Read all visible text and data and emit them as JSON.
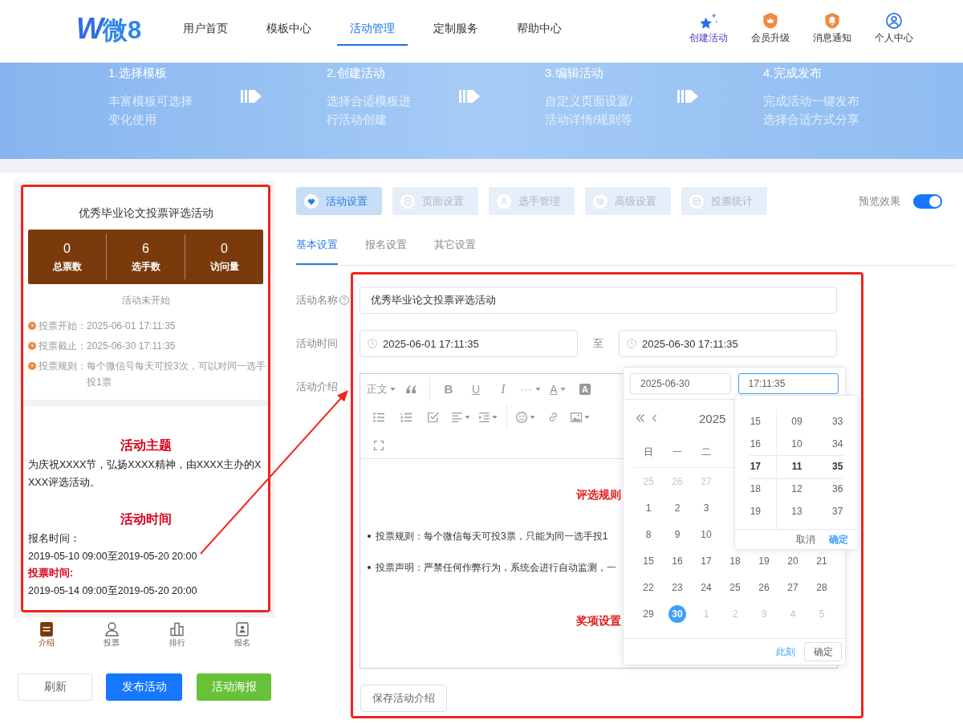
{
  "header": {
    "logo": {
      "mark": "W",
      "text": "微8"
    },
    "nav": [
      {
        "label": "用户首页",
        "selected": false
      },
      {
        "label": "模板中心",
        "selected": false
      },
      {
        "label": "活动管理",
        "selected": true
      },
      {
        "label": "定制服务",
        "selected": false
      },
      {
        "label": "帮助中心",
        "selected": false
      }
    ],
    "actions": [
      {
        "kind": "create",
        "label": "创建活动"
      },
      {
        "kind": "vip",
        "label": "会员升级"
      },
      {
        "kind": "notice",
        "label": "消息通知"
      },
      {
        "kind": "profile",
        "label": "个人中心"
      }
    ]
  },
  "steps": [
    {
      "title": "1.选择模板",
      "lines": [
        "丰富模板可选择",
        "变化使用"
      ]
    },
    {
      "title": "2.创建活动",
      "lines": [
        "选择合适模板进",
        "行活动创建"
      ]
    },
    {
      "title": "3.编辑活动",
      "lines": [
        "自定义页面设置/",
        "活动详情/规则等"
      ]
    },
    {
      "title": "4.完成发布",
      "lines": [
        "完成活动一键发布",
        "选择合适方式分享"
      ]
    }
  ],
  "preview": {
    "title": "优秀毕业论文投票评选活动",
    "stats": [
      {
        "value": "0",
        "label": "总票数"
      },
      {
        "value": "6",
        "label": "选手数"
      },
      {
        "value": "0",
        "label": "访问量"
      }
    ],
    "status": "活动未开始",
    "info": [
      {
        "label": "投票开始：",
        "value": "2025-06-01 17:11:35"
      },
      {
        "label": "投票截止：",
        "value": "2025-06-30 17:11:35"
      },
      {
        "label": "投票规则：",
        "value": "每个微信号每天可投3次，可以对同一选手投1票"
      }
    ],
    "content": [
      {
        "kind": "heading",
        "text": "活动主题"
      },
      {
        "kind": "text",
        "text": "为庆祝XXXX节，弘扬XXXX精神，由XXXX主办的XXXX评选活动。"
      },
      {
        "kind": "heading",
        "text": "活动时间"
      },
      {
        "kind": "text",
        "text": "报名时间："
      },
      {
        "kind": "text",
        "text": "2019-05-10 09:00至2019-05-20 20:00"
      },
      {
        "kind": "label",
        "text": "投票时间:"
      },
      {
        "kind": "text",
        "text": "2019-05-14 09:00至2019-05-20 20:00"
      }
    ],
    "tabbar": [
      {
        "kind": "intro",
        "label": "介绍",
        "selected": true
      },
      {
        "kind": "vote",
        "label": "投票",
        "selected": false
      },
      {
        "kind": "rank",
        "label": "排行",
        "selected": false
      },
      {
        "kind": "signup",
        "label": "报名",
        "selected": false
      }
    ]
  },
  "preview_buttons": [
    {
      "kind": "default",
      "label": "刷新"
    },
    {
      "kind": "primary",
      "label": "发布活动"
    },
    {
      "kind": "success",
      "label": "活动海报"
    }
  ],
  "tabs": [
    {
      "kind": "settings",
      "label": "活动设置",
      "selected": true
    },
    {
      "kind": "page",
      "label": "页面设置",
      "selected": false
    },
    {
      "kind": "players",
      "label": "选手管理",
      "selected": false
    },
    {
      "kind": "advanced",
      "label": "高级设置",
      "selected": false
    },
    {
      "kind": "stats",
      "label": "投票统计",
      "selected": false
    }
  ],
  "preview_toggle": {
    "label": "预览效果",
    "on": true
  },
  "subtabs": [
    {
      "label": "基本设置",
      "selected": true
    },
    {
      "label": "报名设置",
      "selected": false
    },
    {
      "label": "其它设置",
      "selected": false
    }
  ],
  "form": {
    "name": {
      "label": "活动名称",
      "help": true,
      "value": "优秀毕业论文投票评选活动"
    },
    "time": {
      "label": "活动时间",
      "start": "2025-06-01 17:11:35",
      "separator": "至",
      "end": "2025-06-30 17:11:35"
    },
    "intro": {
      "label": "活动介绍"
    },
    "save": "保存活动介绍"
  },
  "editor": {
    "toolbar": [
      [
        {
          "kind": "select",
          "label": "正文"
        },
        {
          "kind": "quote"
        },
        {
          "kind": "divider"
        },
        {
          "kind": "bold",
          "label": "B"
        },
        {
          "kind": "underline",
          "label": "U"
        },
        {
          "kind": "italic",
          "label": "I"
        },
        {
          "kind": "more",
          "label": "···"
        },
        {
          "kind": "color",
          "label": "A"
        },
        {
          "kind": "highlight",
          "label": "A"
        }
      ],
      [
        {
          "kind": "bullets"
        },
        {
          "kind": "numbers"
        },
        {
          "kind": "todo"
        },
        {
          "kind": "align"
        },
        {
          "kind": "indent"
        },
        {
          "kind": "divider"
        },
        {
          "kind": "emoji"
        },
        {
          "kind": "link"
        },
        {
          "kind": "image"
        }
      ],
      [
        {
          "kind": "fullscreen"
        }
      ]
    ],
    "content": [
      {
        "kind": "heading",
        "text": "评选规则"
      },
      {
        "kind": "bullet",
        "text": "投票规则：每个微信每天可投3票，只能为同一选手投1"
      },
      {
        "kind": "bullet",
        "text": "投票声明：严禁任何作弊行为，系统会进行自动监测，一"
      },
      {
        "kind": "heading",
        "text": "奖项设置"
      }
    ]
  },
  "date_picker": {
    "date_input": {
      "value": "2025-06-30",
      "focused": false
    },
    "time_input": {
      "value": "17:11:35",
      "focused": true
    },
    "title": "2025",
    "weekdays": [
      "日",
      "一",
      "二"
    ],
    "weeks": [
      [
        {
          "day": "25",
          "other_month": true,
          "selected": false
        },
        {
          "day": "26",
          "other_month": true,
          "selected": false
        },
        {
          "day": "27",
          "other_month": true,
          "selected": false
        }
      ],
      [
        {
          "day": "1",
          "other_month": false,
          "selected": false
        },
        {
          "day": "2",
          "other_month": false,
          "selected": false
        },
        {
          "day": "3",
          "other_month": false,
          "selected": false
        }
      ],
      [
        {
          "day": "8",
          "other_month": false,
          "selected": false
        },
        {
          "day": "9",
          "other_month": false,
          "selected": false
        },
        {
          "day": "10",
          "other_month": false,
          "selected": false
        }
      ],
      [
        {
          "day": "15",
          "other_month": false,
          "selected": false
        },
        {
          "day": "16",
          "other_month": false,
          "selected": false
        },
        {
          "day": "17",
          "other_month": false,
          "selected": false
        },
        {
          "day": "18",
          "other_month": false,
          "selected": false
        },
        {
          "day": "19",
          "other_month": false,
          "selected": false
        },
        {
          "day": "20",
          "other_month": false,
          "selected": false
        },
        {
          "day": "21",
          "other_month": false,
          "selected": false
        }
      ],
      [
        {
          "day": "22",
          "other_month": false,
          "selected": false
        },
        {
          "day": "23",
          "other_month": false,
          "selected": false
        },
        {
          "day": "24",
          "other_month": false,
          "selected": false
        },
        {
          "day": "25",
          "other_month": false,
          "selected": false
        },
        {
          "day": "26",
          "other_month": false,
          "selected": false
        },
        {
          "day": "27",
          "other_month": false,
          "selected": false
        },
        {
          "day": "28",
          "other_month": false,
          "selected": false
        }
      ],
      [
        {
          "day": "29",
          "other_month": false,
          "selected": false
        },
        {
          "day": "30",
          "other_month": false,
          "selected": true
        },
        {
          "day": "1",
          "other_month": true,
          "selected": false
        },
        {
          "day": "2",
          "other_month": true,
          "selected": false
        },
        {
          "day": "3",
          "other_month": true,
          "selected": false
        },
        {
          "day": "4",
          "other_month": true,
          "selected": false
        },
        {
          "day": "5",
          "other_month": true,
          "selected": false
        }
      ]
    ],
    "now": "此刻",
    "confirm": "确定"
  },
  "time_picker": {
    "columns": [
      [
        {
          "text": "15",
          "selected": false
        },
        {
          "text": "16",
          "selected": false
        },
        {
          "text": "17",
          "selected": true
        },
        {
          "text": "18",
          "selected": false
        },
        {
          "text": "19",
          "selected": false
        }
      ],
      [
        {
          "text": "09",
          "selected": false
        },
        {
          "text": "10",
          "selected": false
        },
        {
          "text": "11",
          "selected": true
        },
        {
          "text": "12",
          "selected": false
        },
        {
          "text": "13",
          "selected": false
        }
      ],
      [
        {
          "text": "33",
          "selected": false
        },
        {
          "text": "34",
          "selected": false
        },
        {
          "text": "35",
          "selected": true
        },
        {
          "text": "36",
          "selected": false
        },
        {
          "text": "37",
          "selected": false
        }
      ]
    ],
    "cancel": "取消",
    "confirm": "确定"
  }
}
